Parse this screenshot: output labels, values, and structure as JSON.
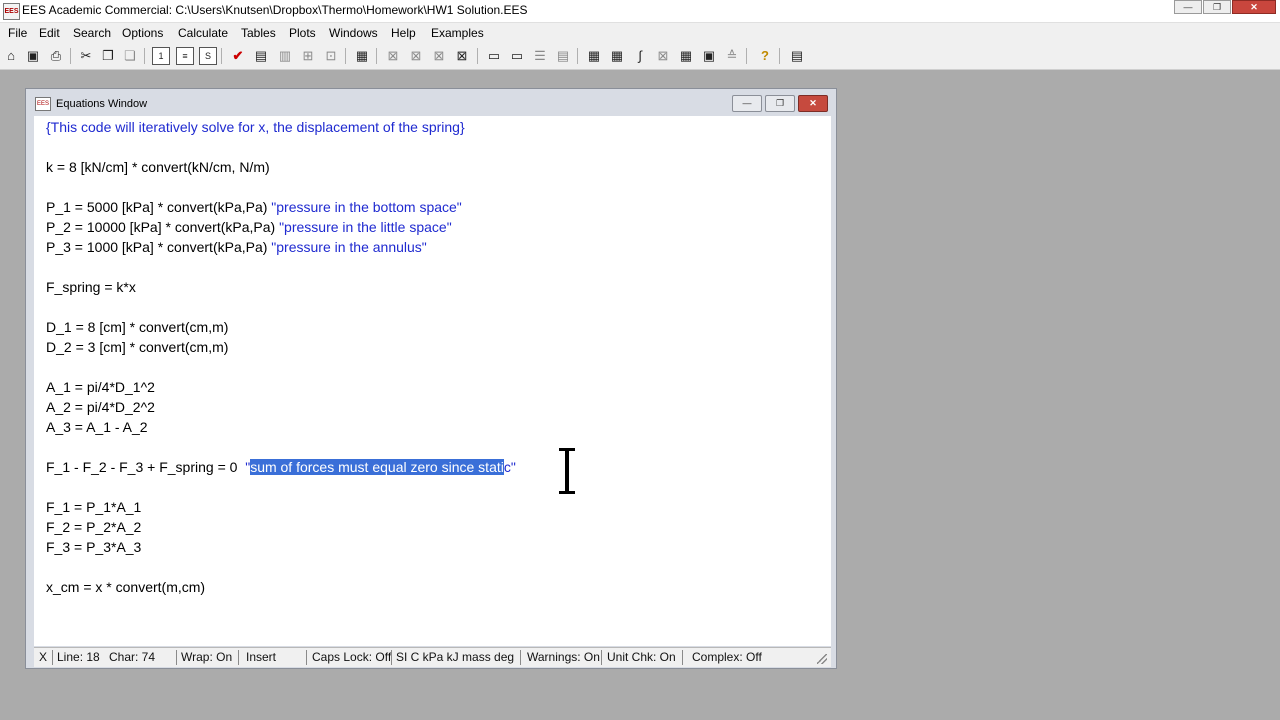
{
  "app": {
    "title": "EES Academic Commercial:  C:\\Users\\Knutsen\\Dropbox\\Thermo\\Homework\\HW1 Solution.EES",
    "icon_label": "EES"
  },
  "window_controls": {
    "minimize": "—",
    "maximize": "❐",
    "close": "✕"
  },
  "menu": [
    "File",
    "Edit",
    "Search",
    "Options",
    "Calculate",
    "Tables",
    "Plots",
    "Windows",
    "Help",
    "Examples"
  ],
  "toolbar_icons": [
    "open-icon",
    "save-icon",
    "print-icon",
    "cut-icon",
    "copy-icon",
    "paste-icon",
    "equations-window-icon",
    "formatted-equations-icon",
    "solution-window-icon",
    "solve-check-icon",
    "calculator-icon",
    "arrays-icon",
    "residuals-icon",
    "report-icon",
    "table-icon",
    "plot1-icon",
    "plot2-icon",
    "plot3-icon",
    "plot4-icon",
    "lookup-icon",
    "parametric-icon",
    "integral-icon",
    "arrays-table-icon",
    "grid-icon",
    "grid2-icon",
    "diagram-icon",
    "table-icon2",
    "chart-icon",
    "property-icon",
    "help-icon",
    "info-icon"
  ],
  "equations_window": {
    "title": "Equations Window",
    "icon_label": "EES",
    "controls": {
      "minimize": "—",
      "maximize": "❐",
      "close": "✕"
    }
  },
  "code": {
    "l1": "{This code will iteratively solve for x, the displacement of the spring}",
    "l2": "k = 8 [kN/cm] * convert(kN/cm, N/m)",
    "l3_code": "P_1 = 5000 [kPa] * convert(kPa,Pa) ",
    "l3_cmt": "\"pressure in the bottom space\"",
    "l4_code": "P_2 = 10000 [kPa] * convert(kPa,Pa) ",
    "l4_cmt": "\"pressure in the little space\"",
    "l5_code": "P_3 = 1000 [kPa] * convert(kPa,Pa) ",
    "l5_cmt": "\"pressure in the annulus\"",
    "l6": "F_spring = k*x",
    "l7": "D_1 = 8 [cm] * convert(cm,m)",
    "l8": "D_2 = 3 [cm] * convert(cm,m)",
    "l9": "A_1 = pi/4*D_1^2",
    "l10": "A_2 = pi/4*D_2^2",
    "l11": "A_3 = A_1 - A_2",
    "l12_code": "F_1 - F_2 - F_3 + F_spring = 0  ",
    "l12_q": "\"",
    "l12_sel": "sum of forces must equal zero since stati",
    "l12_rest": "c\"",
    "l13": "F_1 = P_1*A_1",
    "l14": "F_2 = P_2*A_2",
    "l15": "F_3 = P_3*A_3",
    "l16": "x_cm = x * convert(m,cm)"
  },
  "status": {
    "x": "X",
    "line": "Line: 18",
    "char": "Char: 74",
    "wrap": "Wrap: On",
    "insert": "Insert",
    "caps": "Caps Lock: Off",
    "units": "SI C kPa kJ mass deg",
    "warnings": "Warnings: On",
    "unitchk": "Unit Chk: On",
    "complex": "Complex: Off"
  }
}
